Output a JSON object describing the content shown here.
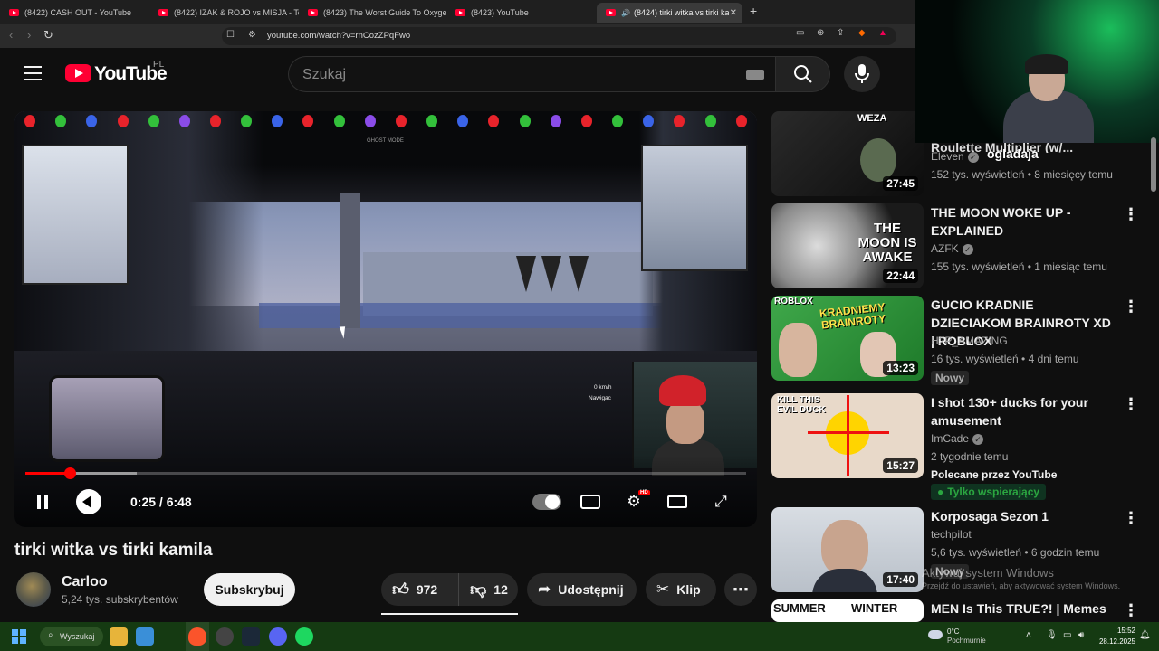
{
  "browser": {
    "tabs": [
      {
        "title": "(8422) CASH OUT - YouTube"
      },
      {
        "title": "(8422) IZAK & ROJO vs MISJA - To się"
      },
      {
        "title": "(8423) The Worst Guide To Oxygen N"
      },
      {
        "title": "(8423) YouTube"
      },
      {
        "title": "(8424) tirki witka vs tirki kamil"
      }
    ],
    "url": "youtube.com/watch?v=rnCozZPqFwo"
  },
  "masthead": {
    "logo_text": "YouTube",
    "country": "PL",
    "search_placeholder": "Szukaj"
  },
  "player": {
    "time_display": "0:25 / 6:48",
    "progress": 0.061,
    "buffered": 0.155,
    "overlay_ghost": "GHOST MODE",
    "overlay_speed": "0 km/h",
    "overlay_nav": "Nawigac",
    "quality_badge": "HD",
    "colors": {
      "progress": "#ff0000"
    }
  },
  "video": {
    "title": "tirki witka vs tirki kamila",
    "channel": "Carloo",
    "subscribers": "5,24 tys. subskrybentów",
    "subscribe_label": "Subskrybuj",
    "likes": "972",
    "dislikes": "12",
    "share_label": "Udostępnij",
    "clip_label": "Klip",
    "more_label": "⋯"
  },
  "recommendations": [
    {
      "title": "Roulette Multiplier (w/...",
      "channel": "Eleven",
      "stats": "152 tys. wyświetleń • 8 miesięcy temu",
      "duration": "27:45",
      "thumb_text": "WEZA"
    },
    {
      "title": "THE MOON WOKE UP - EXPLAINED",
      "channel": "AZFK",
      "stats": "155 tys. wyświetleń • 1 miesiąc temu",
      "duration": "22:44",
      "thumb_text": "THE MOON IS AWAKE"
    },
    {
      "title": "GUCIO KRADNIE DZIECIAKOM BRAINROTY XD | ROBLOX",
      "channel": "H2P_AMAZING",
      "stats": "16 tys. wyświetleń • 4 dni temu",
      "duration": "13:23",
      "badge": "Nowy",
      "thumb_text": "KRADNIEMY BRAINROTY",
      "thumb_brand": "ROBLOX"
    },
    {
      "title": "I shot 130+ ducks for your amusement",
      "channel": "ImCade",
      "stats": "2 tygodnie temu",
      "duration": "15:27",
      "promoted": "Polecane przez YouTube",
      "members": "Tylko wspierający",
      "thumb_text": "KILL THIS EVIL DUCK"
    },
    {
      "title": "Korposaga Sezon 1",
      "channel": "techpilot",
      "stats": "5,6 tys. wyświetleń • 6 godzin temu",
      "duration": "17:40",
      "badge": "Nowy"
    },
    {
      "title": "MEN Is This TRUE?! | Memes",
      "thumb_left": "SUMMER",
      "thumb_right": "WINTER"
    }
  ],
  "streamer_overlay": {
    "label": "ogladaja"
  },
  "windows": {
    "activate_title": "Aktywuj system Windows",
    "activate_sub": "Przejdź do ustawień, aby aktywować system Windows."
  },
  "taskbar": {
    "search_label": "Wyszukaj",
    "temperature": "0°C",
    "weather": "Pochmurnie",
    "time": "15:52",
    "date": "28.12.2025"
  }
}
